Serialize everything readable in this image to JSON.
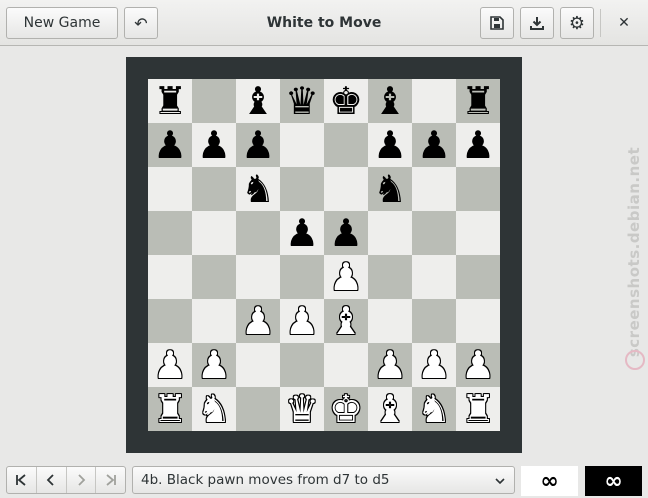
{
  "header": {
    "new_game_label": "New Game",
    "undo_icon": "↶",
    "title": "White to Move",
    "save_icon": "💾",
    "download_icon": "⤓",
    "settings_icon": "⚙",
    "close_icon": "✕"
  },
  "board": {
    "rows": [
      [
        "br",
        "",
        "bb",
        "bq",
        "bk",
        "bb",
        "",
        "br"
      ],
      [
        "bp",
        "bp",
        "bp",
        "",
        "",
        "bp",
        "bp",
        "bp"
      ],
      [
        "",
        "",
        "bn",
        "",
        "",
        "bn",
        "",
        ""
      ],
      [
        "",
        "",
        "",
        "bp",
        "bp",
        "",
        "",
        ""
      ],
      [
        "",
        "",
        "",
        "",
        "wp",
        "",
        "",
        ""
      ],
      [
        "",
        "",
        "wp",
        "wp",
        "wb",
        "",
        "",
        ""
      ],
      [
        "wp",
        "wp",
        "",
        "",
        "",
        "wp",
        "wp",
        "wp"
      ],
      [
        "wr",
        "wn",
        "",
        "wq",
        "wk",
        "wb",
        "wn",
        "wr"
      ]
    ]
  },
  "watermark": "screenshots.debian.net",
  "navigation": {
    "first_icon": "|<",
    "prev_icon": "<",
    "next_icon": ">",
    "last_icon": ">|"
  },
  "history": {
    "current_move": "4b. Black pawn moves from d7 to d5"
  },
  "clocks": {
    "white": "∞",
    "black": "∞"
  }
}
